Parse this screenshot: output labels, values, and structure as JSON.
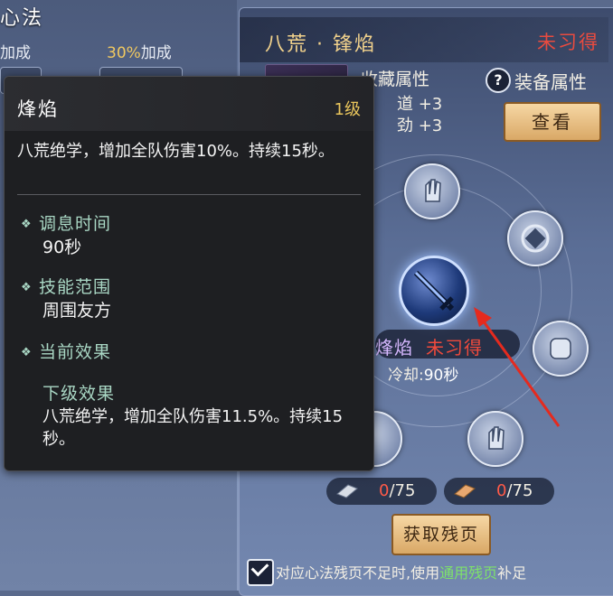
{
  "left": {
    "title": "心法",
    "stat_left": "加成",
    "stat_right_pct": "30%",
    "stat_right_suffix": "加成"
  },
  "card": {
    "title": "八荒 · 锋焰",
    "status": "未习得",
    "collect_label": "收藏属性",
    "attr_1": "道 +3",
    "attr_2": "劲 +3",
    "help_icon": "?",
    "equip_label": "装备属性",
    "view_button": "查看",
    "skill_name": "烽焰",
    "skill_status": "未习得",
    "cooldown_label": "冷却:",
    "cooldown_value": "90秒",
    "frag_1_current": "0",
    "frag_1_total": "/75",
    "frag_2_current": "0",
    "frag_2_total": "/75",
    "get_button": "获取残页",
    "note_prefix": "对应心法残页不足时,使用",
    "note_highlight": "通用残页",
    "note_suffix": "补足",
    "colors": {
      "title": "#f2d28c",
      "status": "#e94b3f",
      "highlight": "#7ee36a"
    }
  },
  "tooltip": {
    "title": "烽焰",
    "level": "1级",
    "desc": "八荒绝学，增加全队伤害10%。持续15秒。",
    "sections": [
      {
        "label": "调息时间",
        "value": "90秒"
      },
      {
        "label": "技能范围",
        "value": "周围友方"
      },
      {
        "label": "当前效果",
        "value": ""
      }
    ],
    "next_label": "下级效果",
    "next_desc": "八荒绝学，增加全队伤害11.5%。持续15秒。"
  }
}
